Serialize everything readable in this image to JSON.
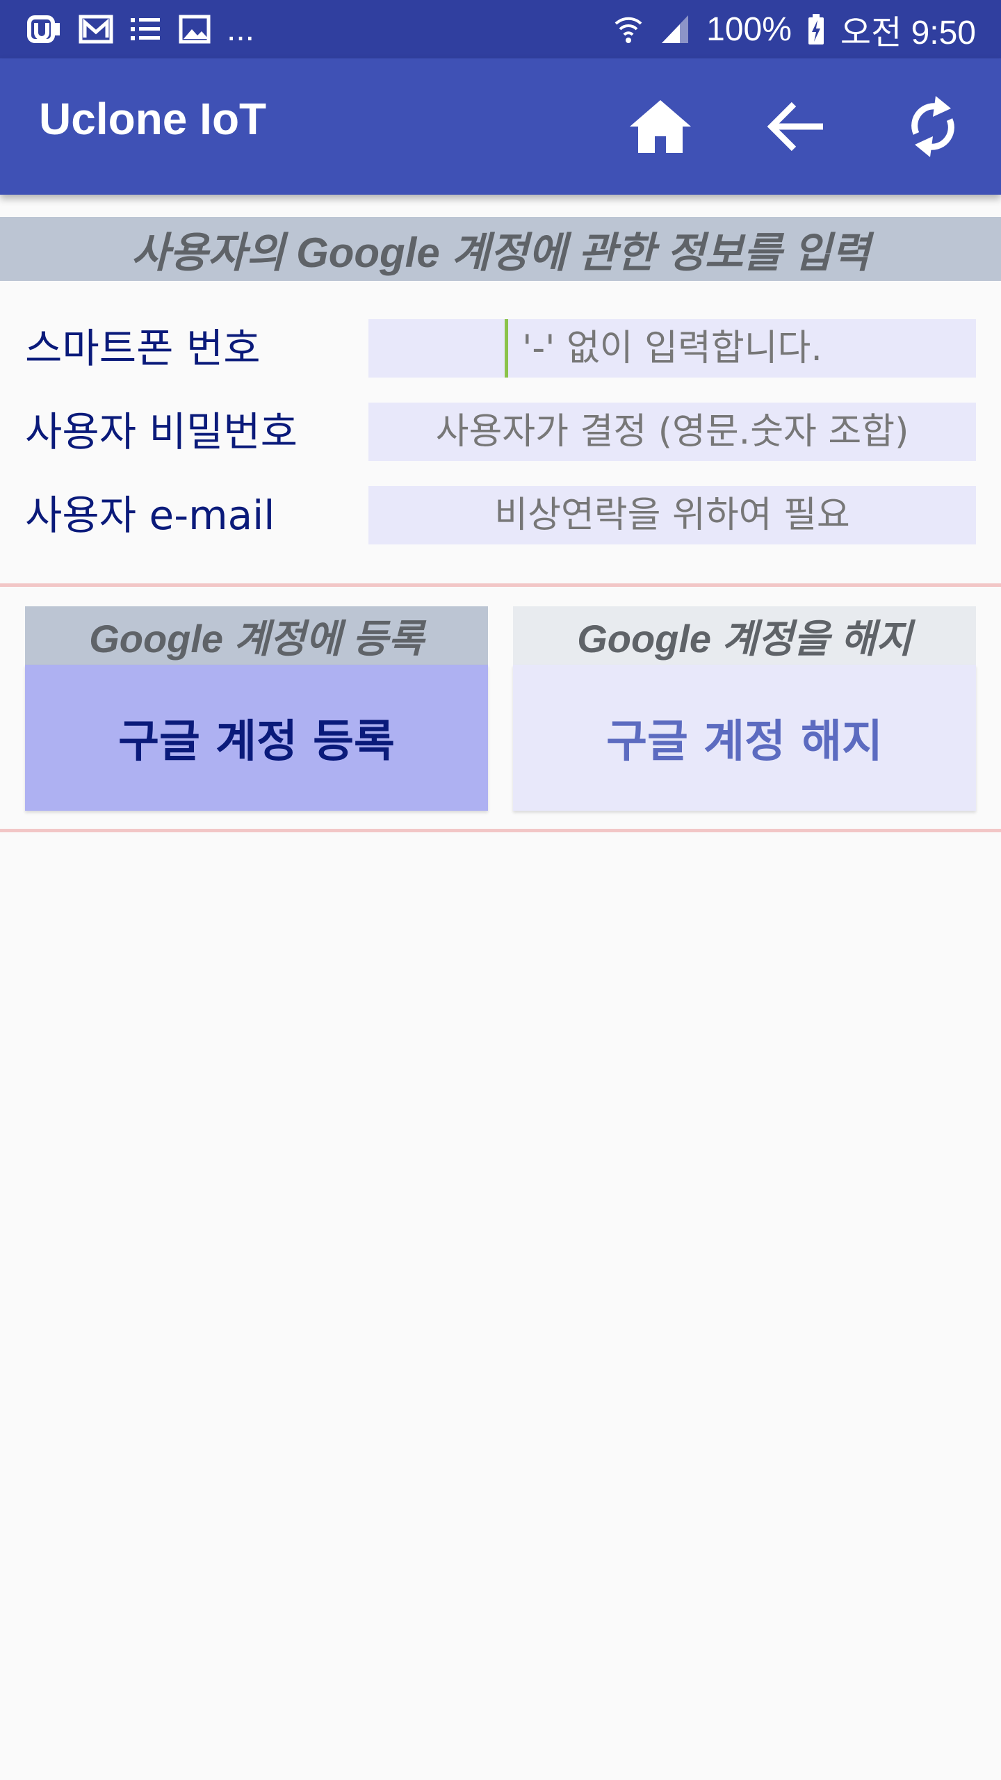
{
  "status_bar": {
    "battery": "100%",
    "time": "오전 9:50",
    "more": "..."
  },
  "app_bar": {
    "title": "Uclone IoT"
  },
  "section_header": "사용자의 Google 계정에 관한 정보를 입력",
  "form": {
    "phone_label": "스마트폰 번호",
    "phone_placeholder": "'-' 없이 입력합니다.",
    "password_label": "사용자 비밀번호",
    "password_placeholder": "사용자가 결정 (영문.숫자 조합)",
    "email_label": "사용자 e-mail",
    "email_placeholder": "비상연락을 위하여 필요"
  },
  "actions": {
    "register_header": "Google 계정에 등록",
    "register_button": "구글 계정 등록",
    "unregister_header": "Google 계정을 해지",
    "unregister_button": "구글 계정 해지"
  },
  "colors": {
    "status_bar": "#303f9f",
    "app_bar": "#3f51b5",
    "register_bg": "#aeb1f2",
    "register_text": "#0a1a7a",
    "unregister_bg": "#e8e8fa",
    "unregister_text": "#5c6bc0"
  }
}
